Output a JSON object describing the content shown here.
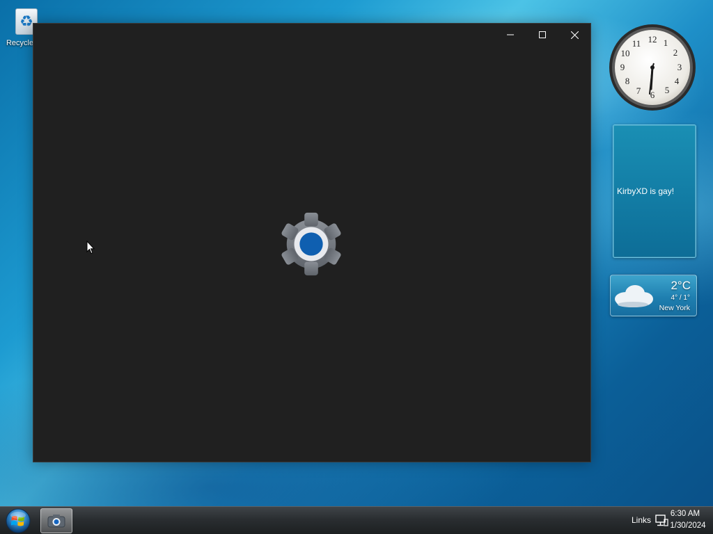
{
  "desktop": {
    "icons": [
      {
        "label": "Recycle Bin",
        "icon": "recycle-bin-icon"
      }
    ]
  },
  "window": {
    "icon": "settings-gear-icon",
    "caption_buttons": {
      "minimize": "—",
      "maximize": "☐",
      "close": "✕"
    },
    "background_color": "#202020",
    "accent_color": "#0f5fb0"
  },
  "gadgets": {
    "clock": {
      "time": "6:30"
    },
    "note": {
      "text": "KirbyXD is gay!"
    },
    "weather": {
      "temperature": "2°C",
      "range": "4° / 1°",
      "city": "New York",
      "icon": "cloud-icon"
    }
  },
  "taskbar": {
    "start_icon": "windows-logo-icon",
    "pinned_item_icon": "camera-icon",
    "links_label": "Links",
    "tray_icon": "network-icon",
    "time": "6:30 AM",
    "date": "1/30/2024"
  }
}
